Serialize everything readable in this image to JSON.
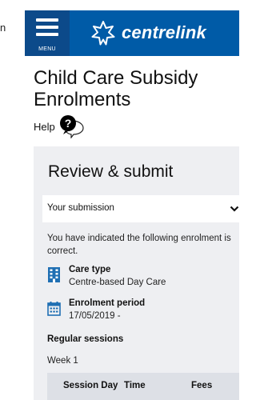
{
  "edge_text": "n",
  "header": {
    "menu_label": "MENU",
    "brand_name": "centrelink",
    "brand_color": "#005ba7"
  },
  "page": {
    "title": "Child Care Subsidy Enrolments",
    "help_label": "Help",
    "help_icon": "help-speech-bubble-icon"
  },
  "card": {
    "heading": "Review & submit",
    "submission_label": "Your submission",
    "indicated_text": "You have indicated the following enrolment is correct.",
    "care_type": {
      "title": "Care type",
      "value": "Centre-based Day Care",
      "icon": "building-icon"
    },
    "enrolment_period": {
      "title": "Enrolment period",
      "value": "17/05/2019 -",
      "icon": "calendar-icon"
    },
    "regular_sessions": "Regular sessions",
    "week": "Week 1",
    "table_headers": [
      "Session Day",
      "Time",
      "Fees"
    ]
  }
}
